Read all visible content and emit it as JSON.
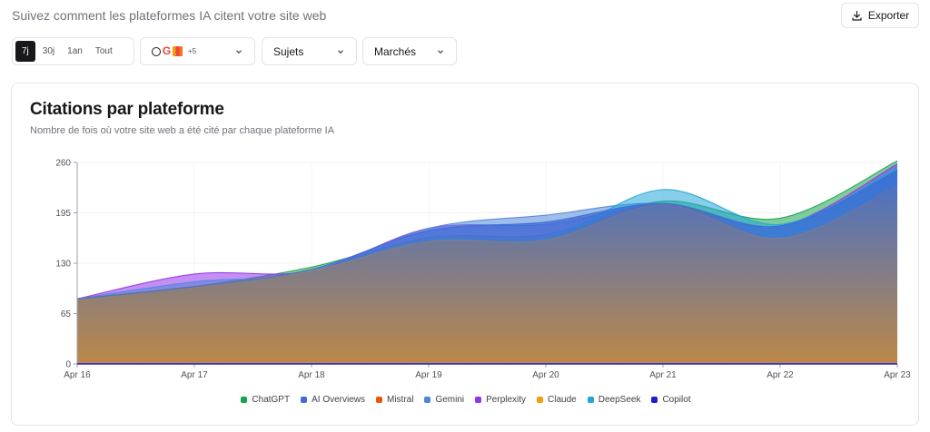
{
  "header": {
    "subtitle": "Suivez comment les plateformes IA citent votre site web",
    "export_label": "Exporter"
  },
  "periods": [
    "7j",
    "30j",
    "1an",
    "Tout"
  ],
  "active_period": "7j",
  "filters": {
    "platforms_extra": "+5",
    "topics_label": "Sujets",
    "markets_label": "Marchés"
  },
  "card": {
    "title": "Citations par plateforme",
    "subtitle": "Nombre de fois où votre site web a été cité par chaque plateforme IA"
  },
  "chart_data": {
    "type": "area",
    "x": [
      "Apr 16",
      "Apr 17",
      "Apr 18",
      "Apr 19",
      "Apr 20",
      "Apr 21",
      "Apr 22",
      "Apr 23"
    ],
    "ylim": [
      0,
      260
    ],
    "yticks": [
      0,
      65,
      130,
      195,
      260
    ],
    "grid": true,
    "legend_position": "bottom",
    "series": [
      {
        "name": "ChatGPT",
        "color": "#16a34a",
        "values": [
          84,
          100,
          125,
          163,
          167,
          210,
          188,
          262
        ]
      },
      {
        "name": "AI Overviews",
        "color": "#3b6fd4",
        "values": [
          84,
          100,
          122,
          172,
          183,
          207,
          178,
          250
        ]
      },
      {
        "name": "Mistral",
        "color": "#ea580c",
        "values": [
          84,
          100,
          120,
          158,
          160,
          207,
          162,
          230
        ]
      },
      {
        "name": "Gemini",
        "color": "#4f86d9",
        "values": [
          84,
          106,
          118,
          175,
          192,
          207,
          175,
          255
        ]
      },
      {
        "name": "Perplexity",
        "color": "#9333ea",
        "values": [
          84,
          116,
          120,
          175,
          180,
          205,
          178,
          258
        ]
      },
      {
        "name": "Claude",
        "color": "#f59e0b",
        "values": [
          84,
          100,
          120,
          158,
          160,
          205,
          162,
          230
        ]
      },
      {
        "name": "DeepSeek",
        "color": "#22a5d8",
        "values": [
          84,
          100,
          117,
          160,
          162,
          225,
          180,
          252
        ]
      },
      {
        "name": "Copilot",
        "color": "#1d1dd6",
        "values": [
          0,
          0,
          0,
          0,
          0,
          0,
          0,
          0
        ]
      }
    ]
  }
}
